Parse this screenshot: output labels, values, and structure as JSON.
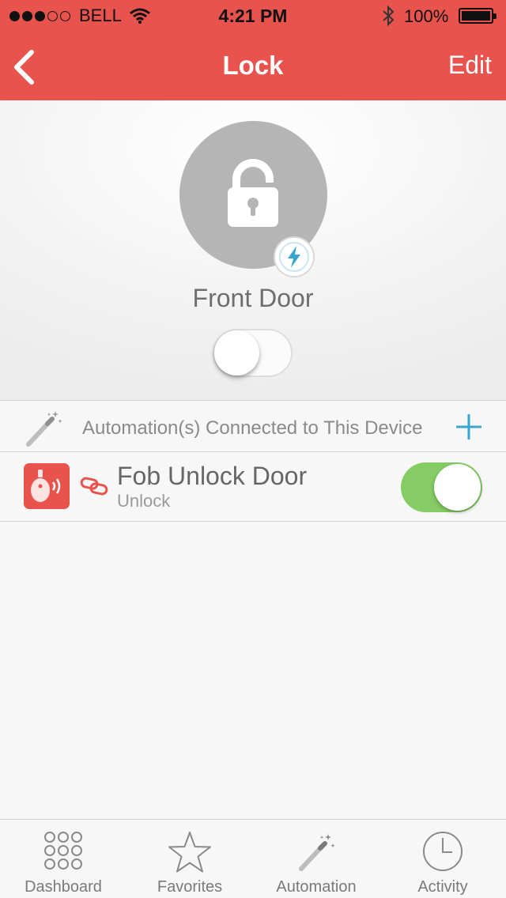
{
  "status_bar": {
    "carrier": "BELL",
    "time": "4:21 PM",
    "battery_percent": "100%",
    "signal_bars_filled": 3,
    "signal_bars_total": 5
  },
  "nav": {
    "title": "Lock",
    "edit_label": "Edit",
    "back_icon": "chevron-left-icon"
  },
  "device": {
    "name": "Front Door",
    "icon": "padlock-unlocked-icon",
    "badge_icon": "lightning-bolt-icon",
    "lock_toggle_on": false
  },
  "automations": {
    "header_label": "Automation(s) Connected to This Device",
    "header_icon": "magic-wand-icon",
    "add_icon": "plus-icon",
    "items": [
      {
        "title": "Fob Unlock Door",
        "subtitle": "Unlock",
        "icon": "key-fob-icon",
        "link_icon": "chain-link-icon",
        "enabled": true
      }
    ]
  },
  "tabbar": {
    "tabs": [
      {
        "label": "Dashboard",
        "icon": "grid-dots-icon"
      },
      {
        "label": "Favorites",
        "icon": "star-icon"
      },
      {
        "label": "Automation",
        "icon": "magic-wand-icon"
      },
      {
        "label": "Activity",
        "icon": "clock-icon"
      }
    ]
  },
  "colors": {
    "brand_red": "#e8534d",
    "toggle_green": "#84cc63",
    "accent_blue": "#3aa6d0",
    "lock_gray": "#b5b5b5"
  }
}
